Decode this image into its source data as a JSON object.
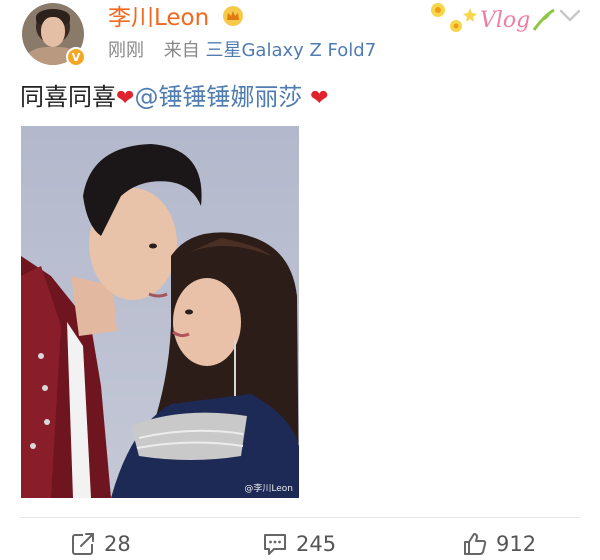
{
  "author": {
    "name": "李川Leon",
    "badge": "V"
  },
  "meta": {
    "time": "刚刚",
    "source_prefix": "来自",
    "source_device": "三星Galaxy Z Fold7"
  },
  "post": {
    "text_before": "同喜同喜",
    "mention": "@锤锤锤娜丽莎",
    "heart": "❤"
  },
  "decoration": {
    "vlog_text": "Vlog"
  },
  "photo": {
    "watermark": "@李川Leon"
  },
  "actions": {
    "share_count": "28",
    "comment_count": "245",
    "like_count": "912"
  },
  "colors": {
    "username": "#f0691e",
    "link": "#4f7cb1",
    "heart": "#e0242f",
    "meta": "#888888"
  },
  "icons": {
    "crown": "crown-icon",
    "chevron": "chevron-down-icon",
    "share": "share-icon",
    "comment": "comment-icon",
    "like": "thumbs-up-icon"
  }
}
